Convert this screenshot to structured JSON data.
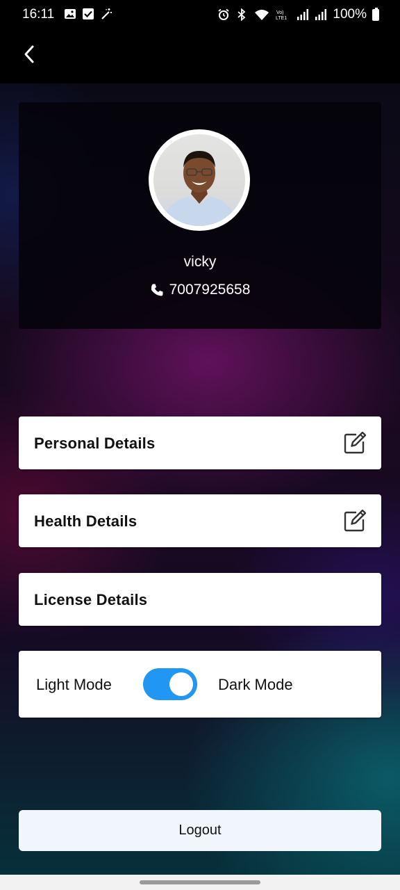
{
  "status_bar": {
    "time": "16:11",
    "battery": "100%",
    "left_icons": [
      "image-icon",
      "check-box-icon",
      "magic-wand-icon"
    ],
    "right_icons": [
      "alarm-icon",
      "bluetooth-icon",
      "wifi-icon",
      "volte-lte-icon",
      "signal-icon",
      "signal-icon",
      "battery-icon"
    ]
  },
  "app_bar": {
    "back_icon": "chevron-left-icon"
  },
  "profile": {
    "name": "vicky",
    "phone": "7007925658",
    "phone_icon": "phone-icon"
  },
  "menu": {
    "items": [
      {
        "label": "Personal Details",
        "icon": "edit-icon"
      },
      {
        "label": "Health Details",
        "icon": "edit-icon"
      },
      {
        "label": "License Details"
      }
    ]
  },
  "theme": {
    "light_label": "Light Mode",
    "dark_label": "Dark Mode",
    "toggle_on": true,
    "accent": "#2196f3"
  },
  "logout": {
    "label": "Logout"
  }
}
